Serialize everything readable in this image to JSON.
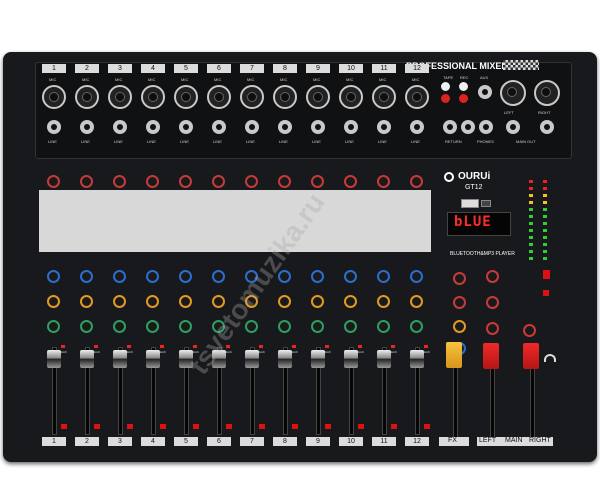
{
  "panel": {
    "title": "PROFESSIONAL MIXER",
    "brand": "OURUi",
    "model": "GT12",
    "player_label": "BLUETOOTH&MP3 PLAYER",
    "display_text": "bLUE",
    "watermark": "tsvetomuzika.ru"
  },
  "channels": [
    "1",
    "2",
    "3",
    "4",
    "5",
    "6",
    "7",
    "8",
    "9",
    "10",
    "11",
    "12"
  ],
  "strip_labels": {
    "mic": "MIC",
    "line": "LINE",
    "peak": "PEAK"
  },
  "io": {
    "tape": "TAPE",
    "rec": "REC",
    "aux": "AUX",
    "left": "LEFT",
    "right": "RIGHT",
    "return": "RETURN",
    "phones": "PHONES",
    "main_out": "MAIN OUT"
  },
  "master": {
    "fx": "FX",
    "left": "LEFT",
    "main": "MAIN",
    "right": "RIGHT"
  },
  "colors": {
    "panel": "#17191c",
    "eq_section": "#d8d8d8",
    "gain_knob": "#c83a3a",
    "aux_knob": "#2a6fd0",
    "fx_knob": "#e39a22",
    "pan_knob": "#2f9e62",
    "fx_fader": "#f0b020",
    "main_fader": "#d62020"
  }
}
